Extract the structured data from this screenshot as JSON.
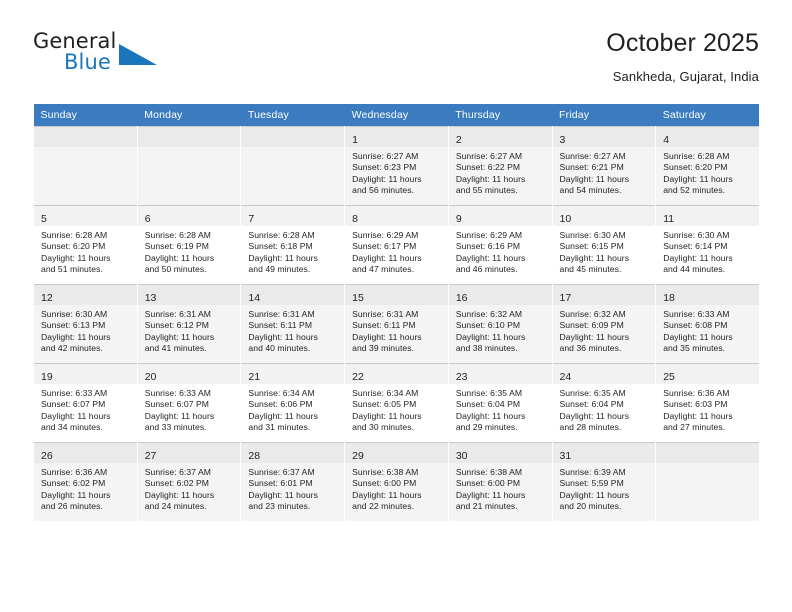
{
  "brand": {
    "line1": "General",
    "line2": "Blue",
    "mark": "triangle-logo"
  },
  "header": {
    "title": "October 2025",
    "subtitle": "Sankheda, Gujarat, India"
  },
  "weekdays": [
    "Sunday",
    "Monday",
    "Tuesday",
    "Wednesday",
    "Thursday",
    "Friday",
    "Saturday"
  ],
  "labels": {
    "sunrise": "Sunrise:",
    "sunset": "Sunset:",
    "daylight": "Daylight:"
  },
  "colors": {
    "header_blue": "#3b7cc0",
    "brand_blue": "#1b75bb",
    "text": "#231f20",
    "row_shade": "#f4f4f4",
    "daynum_shade": "#f2f2f2",
    "grid_line": "#c9c9c9"
  },
  "weeks": [
    [
      {
        "day": "",
        "empty": true
      },
      {
        "day": "",
        "empty": true
      },
      {
        "day": "",
        "empty": true
      },
      {
        "day": "1",
        "sunrise": "Sunrise: 6:27 AM",
        "sunset": "Sunset: 6:23 PM",
        "daylight1": "Daylight: 11 hours",
        "daylight2": "and 56 minutes."
      },
      {
        "day": "2",
        "sunrise": "Sunrise: 6:27 AM",
        "sunset": "Sunset: 6:22 PM",
        "daylight1": "Daylight: 11 hours",
        "daylight2": "and 55 minutes."
      },
      {
        "day": "3",
        "sunrise": "Sunrise: 6:27 AM",
        "sunset": "Sunset: 6:21 PM",
        "daylight1": "Daylight: 11 hours",
        "daylight2": "and 54 minutes."
      },
      {
        "day": "4",
        "sunrise": "Sunrise: 6:28 AM",
        "sunset": "Sunset: 6:20 PM",
        "daylight1": "Daylight: 11 hours",
        "daylight2": "and 52 minutes."
      }
    ],
    [
      {
        "day": "5",
        "sunrise": "Sunrise: 6:28 AM",
        "sunset": "Sunset: 6:20 PM",
        "daylight1": "Daylight: 11 hours",
        "daylight2": "and 51 minutes."
      },
      {
        "day": "6",
        "sunrise": "Sunrise: 6:28 AM",
        "sunset": "Sunset: 6:19 PM",
        "daylight1": "Daylight: 11 hours",
        "daylight2": "and 50 minutes."
      },
      {
        "day": "7",
        "sunrise": "Sunrise: 6:28 AM",
        "sunset": "Sunset: 6:18 PM",
        "daylight1": "Daylight: 11 hours",
        "daylight2": "and 49 minutes."
      },
      {
        "day": "8",
        "sunrise": "Sunrise: 6:29 AM",
        "sunset": "Sunset: 6:17 PM",
        "daylight1": "Daylight: 11 hours",
        "daylight2": "and 47 minutes."
      },
      {
        "day": "9",
        "sunrise": "Sunrise: 6:29 AM",
        "sunset": "Sunset: 6:16 PM",
        "daylight1": "Daylight: 11 hours",
        "daylight2": "and 46 minutes."
      },
      {
        "day": "10",
        "sunrise": "Sunrise: 6:30 AM",
        "sunset": "Sunset: 6:15 PM",
        "daylight1": "Daylight: 11 hours",
        "daylight2": "and 45 minutes."
      },
      {
        "day": "11",
        "sunrise": "Sunrise: 6:30 AM",
        "sunset": "Sunset: 6:14 PM",
        "daylight1": "Daylight: 11 hours",
        "daylight2": "and 44 minutes."
      }
    ],
    [
      {
        "day": "12",
        "sunrise": "Sunrise: 6:30 AM",
        "sunset": "Sunset: 6:13 PM",
        "daylight1": "Daylight: 11 hours",
        "daylight2": "and 42 minutes."
      },
      {
        "day": "13",
        "sunrise": "Sunrise: 6:31 AM",
        "sunset": "Sunset: 6:12 PM",
        "daylight1": "Daylight: 11 hours",
        "daylight2": "and 41 minutes."
      },
      {
        "day": "14",
        "sunrise": "Sunrise: 6:31 AM",
        "sunset": "Sunset: 6:11 PM",
        "daylight1": "Daylight: 11 hours",
        "daylight2": "and 40 minutes."
      },
      {
        "day": "15",
        "sunrise": "Sunrise: 6:31 AM",
        "sunset": "Sunset: 6:11 PM",
        "daylight1": "Daylight: 11 hours",
        "daylight2": "and 39 minutes."
      },
      {
        "day": "16",
        "sunrise": "Sunrise: 6:32 AM",
        "sunset": "Sunset: 6:10 PM",
        "daylight1": "Daylight: 11 hours",
        "daylight2": "and 38 minutes."
      },
      {
        "day": "17",
        "sunrise": "Sunrise: 6:32 AM",
        "sunset": "Sunset: 6:09 PM",
        "daylight1": "Daylight: 11 hours",
        "daylight2": "and 36 minutes."
      },
      {
        "day": "18",
        "sunrise": "Sunrise: 6:33 AM",
        "sunset": "Sunset: 6:08 PM",
        "daylight1": "Daylight: 11 hours",
        "daylight2": "and 35 minutes."
      }
    ],
    [
      {
        "day": "19",
        "sunrise": "Sunrise: 6:33 AM",
        "sunset": "Sunset: 6:07 PM",
        "daylight1": "Daylight: 11 hours",
        "daylight2": "and 34 minutes."
      },
      {
        "day": "20",
        "sunrise": "Sunrise: 6:33 AM",
        "sunset": "Sunset: 6:07 PM",
        "daylight1": "Daylight: 11 hours",
        "daylight2": "and 33 minutes."
      },
      {
        "day": "21",
        "sunrise": "Sunrise: 6:34 AM",
        "sunset": "Sunset: 6:06 PM",
        "daylight1": "Daylight: 11 hours",
        "daylight2": "and 31 minutes."
      },
      {
        "day": "22",
        "sunrise": "Sunrise: 6:34 AM",
        "sunset": "Sunset: 6:05 PM",
        "daylight1": "Daylight: 11 hours",
        "daylight2": "and 30 minutes."
      },
      {
        "day": "23",
        "sunrise": "Sunrise: 6:35 AM",
        "sunset": "Sunset: 6:04 PM",
        "daylight1": "Daylight: 11 hours",
        "daylight2": "and 29 minutes."
      },
      {
        "day": "24",
        "sunrise": "Sunrise: 6:35 AM",
        "sunset": "Sunset: 6:04 PM",
        "daylight1": "Daylight: 11 hours",
        "daylight2": "and 28 minutes."
      },
      {
        "day": "25",
        "sunrise": "Sunrise: 6:36 AM",
        "sunset": "Sunset: 6:03 PM",
        "daylight1": "Daylight: 11 hours",
        "daylight2": "and 27 minutes."
      }
    ],
    [
      {
        "day": "26",
        "sunrise": "Sunrise: 6:36 AM",
        "sunset": "Sunset: 6:02 PM",
        "daylight1": "Daylight: 11 hours",
        "daylight2": "and 26 minutes."
      },
      {
        "day": "27",
        "sunrise": "Sunrise: 6:37 AM",
        "sunset": "Sunset: 6:02 PM",
        "daylight1": "Daylight: 11 hours",
        "daylight2": "and 24 minutes."
      },
      {
        "day": "28",
        "sunrise": "Sunrise: 6:37 AM",
        "sunset": "Sunset: 6:01 PM",
        "daylight1": "Daylight: 11 hours",
        "daylight2": "and 23 minutes."
      },
      {
        "day": "29",
        "sunrise": "Sunrise: 6:38 AM",
        "sunset": "Sunset: 6:00 PM",
        "daylight1": "Daylight: 11 hours",
        "daylight2": "and 22 minutes."
      },
      {
        "day": "30",
        "sunrise": "Sunrise: 6:38 AM",
        "sunset": "Sunset: 6:00 PM",
        "daylight1": "Daylight: 11 hours",
        "daylight2": "and 21 minutes."
      },
      {
        "day": "31",
        "sunrise": "Sunrise: 6:39 AM",
        "sunset": "Sunset: 5:59 PM",
        "daylight1": "Daylight: 11 hours",
        "daylight2": "and 20 minutes."
      },
      {
        "day": "",
        "empty": true
      }
    ]
  ]
}
